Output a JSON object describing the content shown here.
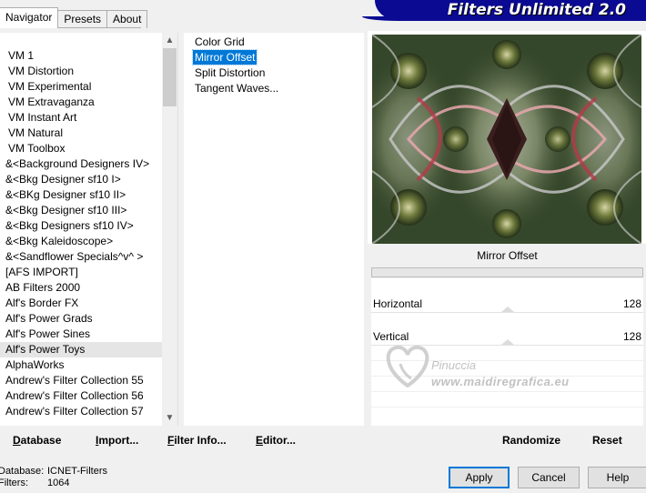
{
  "tabs": [
    {
      "label": "Navigator",
      "active": true
    },
    {
      "label": "Presets",
      "active": false
    },
    {
      "label": "About",
      "active": false
    }
  ],
  "banner": {
    "title": "Filters Unlimited 2.0",
    "background": "#0a0a92"
  },
  "categories": {
    "selected_index": 19,
    "items": [
      "VM 1",
      "VM Distortion",
      "VM Experimental",
      "VM Extravaganza",
      "VM Instant Art",
      "VM Natural",
      "VM Toolbox",
      "&<Background Designers IV>",
      "&<Bkg Designer sf10 I>",
      "&<BKg Designer sf10 II>",
      "&<Bkg Designer sf10 III>",
      "&<Bkg Designers sf10 IV>",
      "&<Bkg Kaleidoscope>",
      "&<Sandflower Specials^v^ >",
      "[AFS IMPORT]",
      "AB Filters 2000",
      "Alf's Border FX",
      "Alf's Power Grads",
      "Alf's Power Sines",
      "Alf's Power Toys",
      "AlphaWorks",
      "Andrew's Filter Collection 55",
      "Andrew's Filter Collection 56",
      "Andrew's Filter Collection 57"
    ]
  },
  "filters": {
    "selected_index": 1,
    "items": [
      "Color Grid",
      "Mirror Offset",
      "Split Distortion",
      "Tangent Waves..."
    ]
  },
  "preview": {
    "filter_name": "Mirror Offset",
    "progress": 0
  },
  "params": [
    {
      "label": "Horizontal",
      "value": "128",
      "level": 0.5
    },
    {
      "label": "Vertical",
      "value": "128",
      "level": 0.5
    }
  ],
  "watermark": {
    "name": "Pinuccia",
    "site": "www.maidiregrafica.eu"
  },
  "toolbar_left": [
    {
      "key": "D",
      "rest": "atabase"
    },
    {
      "key": "I",
      "rest": "mport..."
    },
    {
      "key": "F",
      "rest": "ilter Info..."
    },
    {
      "key": "E",
      "rest": "ditor..."
    }
  ],
  "toolbar_right": {
    "randomize": "Randomize",
    "reset": "Reset"
  },
  "info": {
    "database_label": "Database:",
    "database_value": "ICNET-Filters",
    "filters_label": "Filters:",
    "filters_value": "1064"
  },
  "buttons": {
    "apply": "Apply",
    "cancel": "Cancel",
    "help": "Help"
  }
}
